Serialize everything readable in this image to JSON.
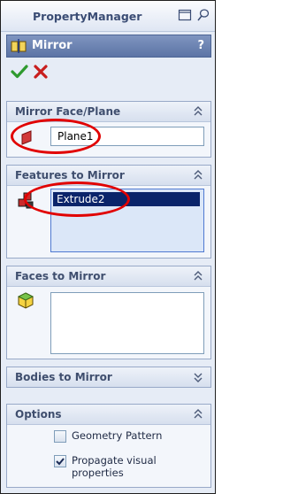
{
  "header": {
    "title": "PropertyManager"
  },
  "feature": {
    "name": "Mirror",
    "help": "?"
  },
  "actions": {
    "ok_icon": "check-icon",
    "cancel_icon": "cross-icon"
  },
  "groups": {
    "mirror_face": {
      "title": "Mirror Face/Plane",
      "value": "Plane1"
    },
    "features": {
      "title": "Features to Mirror",
      "selected": "Extrude2"
    },
    "faces": {
      "title": "Faces to Mirror"
    },
    "bodies": {
      "title": "Bodies to Mirror"
    },
    "options": {
      "title": "Options",
      "geometry_pattern": {
        "label": "Geometry Pattern",
        "checked": false
      },
      "propagate": {
        "label_line1": "Propagate visual",
        "label_line2": "properties",
        "checked": true
      }
    }
  },
  "colors": {
    "selection": "#0a246a",
    "accent": "#5c74a5",
    "annotation": "#e10000"
  }
}
